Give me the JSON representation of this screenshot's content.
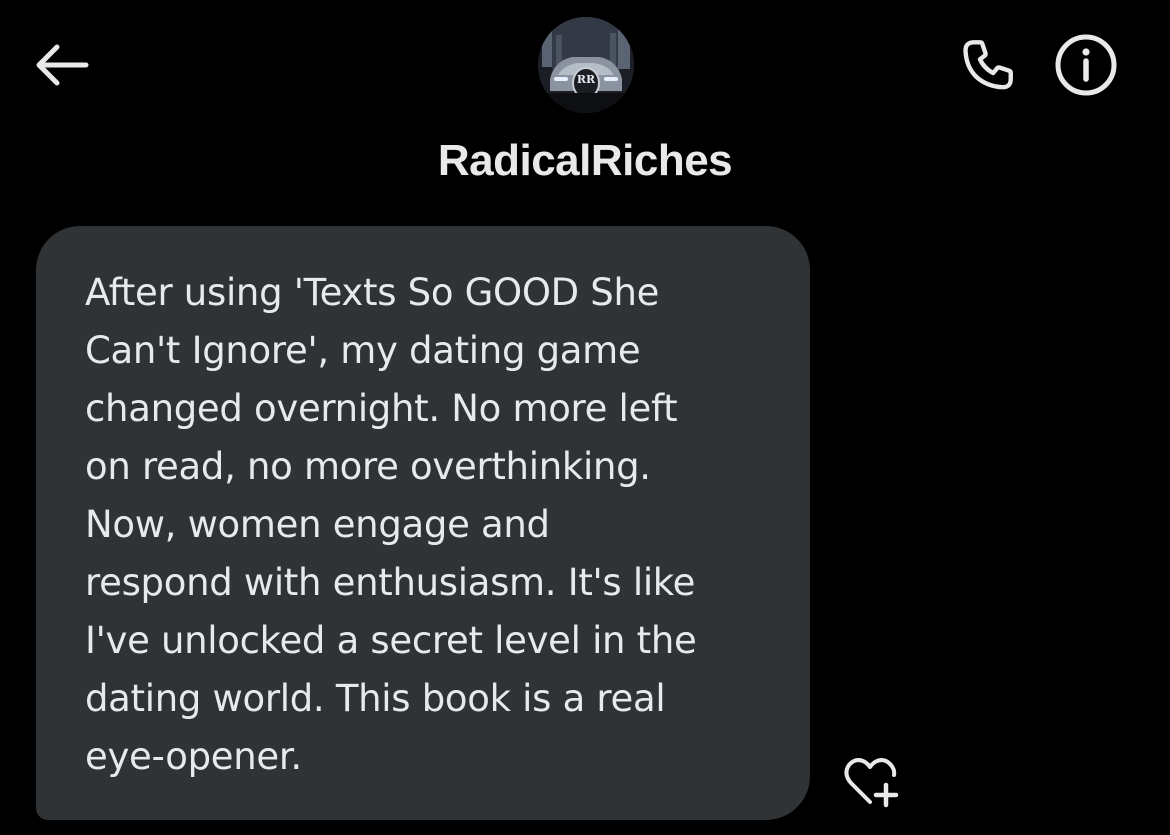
{
  "header": {
    "contact_name": "RadicalRiches",
    "avatar_badge": "RR",
    "icons": {
      "back": "arrow-left-icon",
      "call": "phone-icon",
      "info": "info-icon"
    }
  },
  "message": {
    "text": "After using 'Texts So GOOD She\nCan't Ignore', my dating game\nchanged overnight. No more left\non read, no more overthinking.\nNow, women engage and\nrespond with enthusiasm. It's like\nI've unlocked a secret level in the\ndating world. This book is a real\neye-opener."
  },
  "reaction": {
    "icon": "heart-plus-icon"
  },
  "colors": {
    "background": "#000000",
    "bubble": "#2f3336",
    "text": "#e7e9ea",
    "icon": "#e7e9ea"
  }
}
